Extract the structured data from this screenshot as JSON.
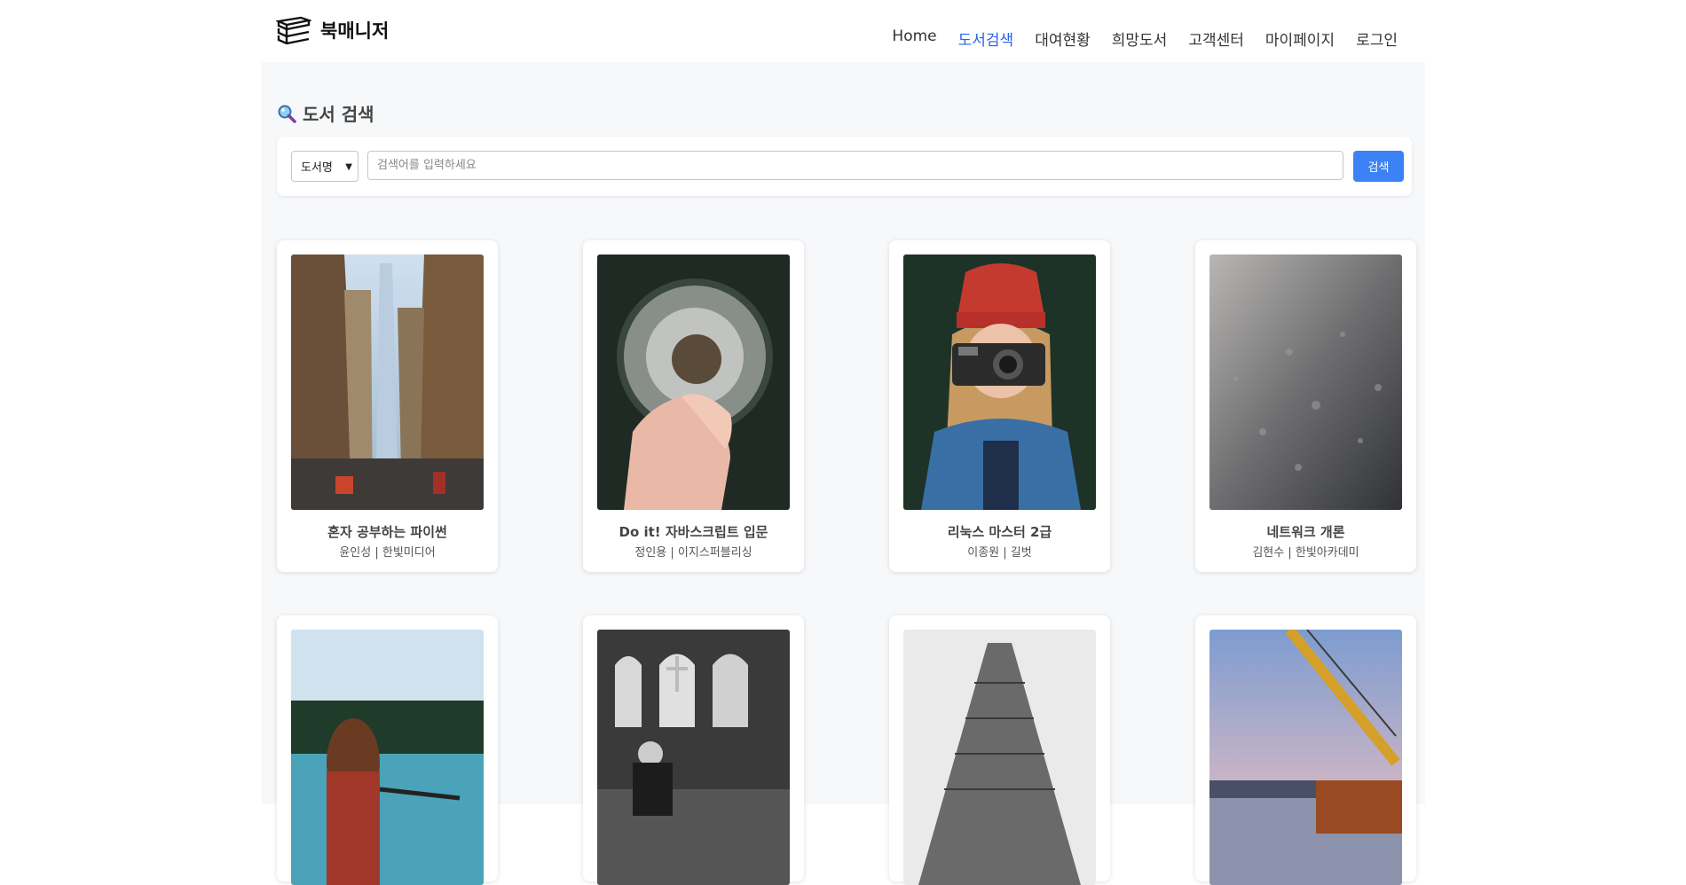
{
  "brand": {
    "name": "북매니저",
    "icon": "books-icon"
  },
  "nav": {
    "items": [
      "Home",
      "도서검색",
      "대여현황",
      "희망도서",
      "고객센터",
      "마이페이지",
      "로그인"
    ],
    "active_index": 1
  },
  "page": {
    "title": "도서 검색",
    "title_icon": "magnifier-icon"
  },
  "search": {
    "select_value": "도서명",
    "placeholder": "검색어를 입력하세요",
    "button_label": "검색"
  },
  "colors": {
    "accent": "#3b82f6",
    "nav_active": "#2563eb",
    "background": "#f7f8fa"
  },
  "books": [
    {
      "title": "혼자 공부하는 파이썬",
      "meta": "윤인성 | 한빛미디어",
      "cover": "city-skyscraper-photo"
    },
    {
      "title": "Do it! 자바스크립트 입문",
      "meta": "정인용 | 이지스퍼블리싱",
      "cover": "dandelion-photo"
    },
    {
      "title": "리눅스 마스터 2급",
      "meta": "이종원 | 길벗",
      "cover": "woman-camera-photo"
    },
    {
      "title": "네트워크 개론",
      "meta": "김현수 | 한빛아카데미",
      "cover": "wet-surface-photo"
    },
    {
      "title": "",
      "meta": "",
      "cover": "lake-woman-photo"
    },
    {
      "title": "",
      "meta": "",
      "cover": "church-interior-photo"
    },
    {
      "title": "",
      "meta": "",
      "cover": "flatiron-building-photo"
    },
    {
      "title": "",
      "meta": "",
      "cover": "harbor-crane-photo"
    }
  ]
}
